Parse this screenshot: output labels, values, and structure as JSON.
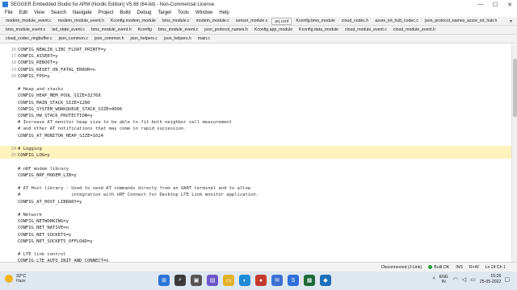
{
  "window": {
    "title": "SEGGER Embedded Studio for ARM (Nordic Edition) V5.68 (64-bit) - Non-Commercial License",
    "controls": {
      "minimize": "—",
      "maximize": "☐",
      "close": "✕"
    }
  },
  "menu": [
    "File",
    "Edit",
    "View",
    "Search",
    "Navigate",
    "Project",
    "Build",
    "Debug",
    "Target",
    "Tools",
    "Window",
    "Help"
  ],
  "tabs": {
    "row1": [
      "modem_module_event.c",
      "modem_module_event.h",
      "Kconfig.modem_module",
      "bms_module.c",
      "modem_module.c",
      "sensor_module.c",
      "prj.conf",
      "Kconfig.bms_module",
      "cloud_codec.h",
      "azure_iot_hub_codec.c",
      "json_protocol_names_azure_iot_hub.h"
    ],
    "row1_active": "prj.conf",
    "row2": [
      "bms_module_event.c",
      "led_state_event.c",
      "bms_module_event.h",
      "Kconfig",
      "bms_module_event.c",
      "json_protocol_names.h",
      "Kconfig.app_module",
      "Kconfig.data_module",
      "cloud_module_event.c",
      "cloud_module_event.h"
    ],
    "row3": [
      "cloud_codec_ringbuffer.c",
      "json_common.c",
      "json_common.h",
      "json_helpers.c",
      "json_helpers.h",
      "main.c"
    ]
  },
  "editor": {
    "lines": [
      {
        "num": "16",
        "text": "CONFIG_NEWLIB_LIBC_FLOAT_PRINTF=y",
        "hl": false
      },
      {
        "num": "17",
        "text": "CONFIG_ASSERT=y",
        "hl": false
      },
      {
        "num": "18",
        "text": "CONFIG_REBOOT=y",
        "hl": false
      },
      {
        "num": "19",
        "text": "CONFIG_RESET_ON_FATAL_ERROR=n",
        "hl": false
      },
      {
        "num": "20",
        "text": "CONFIG_FPU=y",
        "hl": false
      },
      {
        "num": "",
        "text": "",
        "hl": false
      },
      {
        "num": "",
        "text": "# Heap and stacks",
        "hl": false
      },
      {
        "num": "",
        "text": "CONFIG_HEAP_MEM_POOL_SIZE=32768",
        "hl": false
      },
      {
        "num": "",
        "text": "CONFIG_MAIN_STACK_SIZE=1280",
        "hl": false
      },
      {
        "num": "",
        "text": "CONFIG_SYSTEM_WORKQUEUE_STACK_SIZE=4096",
        "hl": false
      },
      {
        "num": "",
        "text": "CONFIG_HW_STACK_PROTECTION=y",
        "hl": false
      },
      {
        "num": "",
        "text": "# Increase AT monitor heap size to be able to fit both neighbor cell measurement",
        "hl": false
      },
      {
        "num": "",
        "text": "# and other AT notifications that may come in rapid succession.",
        "hl": false
      },
      {
        "num": "",
        "text": "CONFIG_AT_MONITOR_HEAP_SIZE=1024",
        "hl": false
      },
      {
        "num": "",
        "text": "",
        "hl": false
      },
      {
        "num": "24",
        "text": "# Logging",
        "hl": true
      },
      {
        "num": "25",
        "text": "CONFIG_LOG=y",
        "hl": true
      },
      {
        "num": "",
        "text": "",
        "hl": false
      },
      {
        "num": "",
        "text": "# nRF modem library",
        "hl": false
      },
      {
        "num": "",
        "text": "CONFIG_NRF_MODEM_LIB=y",
        "hl": false
      },
      {
        "num": "",
        "text": "",
        "hl": false
      },
      {
        "num": "",
        "text": "# AT Host library - Used to send AT commands directy from an UART terminal and to allow",
        "hl": false
      },
      {
        "num": "",
        "text": "#                   integration with nRF Connect for Desktop LTE Link monitor application.",
        "hl": false
      },
      {
        "num": "",
        "text": "CONFIG_AT_HOST_LIBRARY=y",
        "hl": false
      },
      {
        "num": "",
        "text": "",
        "hl": false
      },
      {
        "num": "",
        "text": "# Network",
        "hl": false
      },
      {
        "num": "",
        "text": "CONFIG_NETWORKING=y",
        "hl": false
      },
      {
        "num": "",
        "text": "CONFIG_NET_NATIVE=n",
        "hl": false
      },
      {
        "num": "",
        "text": "CONFIG_NET_SOCKETS=y",
        "hl": false
      },
      {
        "num": "",
        "text": "CONFIG_NET_SOCKETS_OFFLOAD=y",
        "hl": false
      },
      {
        "num": "",
        "text": "",
        "hl": false
      },
      {
        "num": "",
        "text": "# LTE link control",
        "hl": false
      },
      {
        "num": "",
        "text": "CONFIG_LTE_AUTO_INIT_AND_CONNECT=n",
        "hl": false
      }
    ]
  },
  "status": {
    "connection": "Disconnected (J-Link)",
    "build": "Built OK",
    "mode": "INS",
    "rw": "R+W",
    "position": "Ln 24 Ch 1"
  },
  "taskbar": {
    "weather_temp": "32°C",
    "weather_cond": "Haze",
    "lang_top": "ENG",
    "lang_bottom": "IN",
    "time": "15:26",
    "date": "25-05-2022"
  },
  "colors": {
    "highlight_line": "#fff3bf",
    "build_ok": "#1e9e3e",
    "taskbar_bg": "#dfe7f1"
  }
}
